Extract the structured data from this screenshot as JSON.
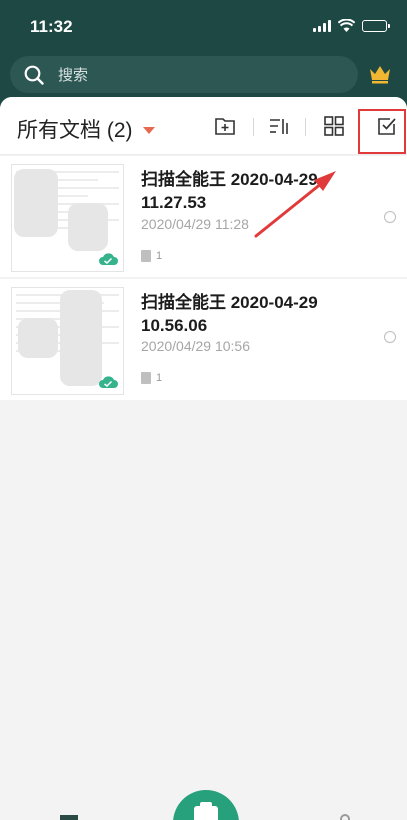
{
  "status_bar": {
    "time": "11:32"
  },
  "search": {
    "placeholder": "搜索"
  },
  "header": {
    "title": "所有文档 (2)"
  },
  "documents": [
    {
      "name": "扫描全能王 2020-04-29 11.27.53",
      "date": "2020/04/29 11:28",
      "pages": "1",
      "synced": true
    },
    {
      "name": "扫描全能王 2020-04-29 10.56.06",
      "date": "2020/04/29 10:56",
      "pages": "1",
      "synced": true
    }
  ],
  "colors": {
    "top_bar": "#1e4844",
    "accent": "#27a07c",
    "highlight_box": "#e03a3a",
    "caret": "#e56a4f"
  },
  "icons": [
    "search-icon",
    "crown-icon",
    "new-folder-icon",
    "sort-icon",
    "grid-view-icon",
    "select-mode-icon",
    "cloud-synced-icon",
    "camera-icon"
  ]
}
